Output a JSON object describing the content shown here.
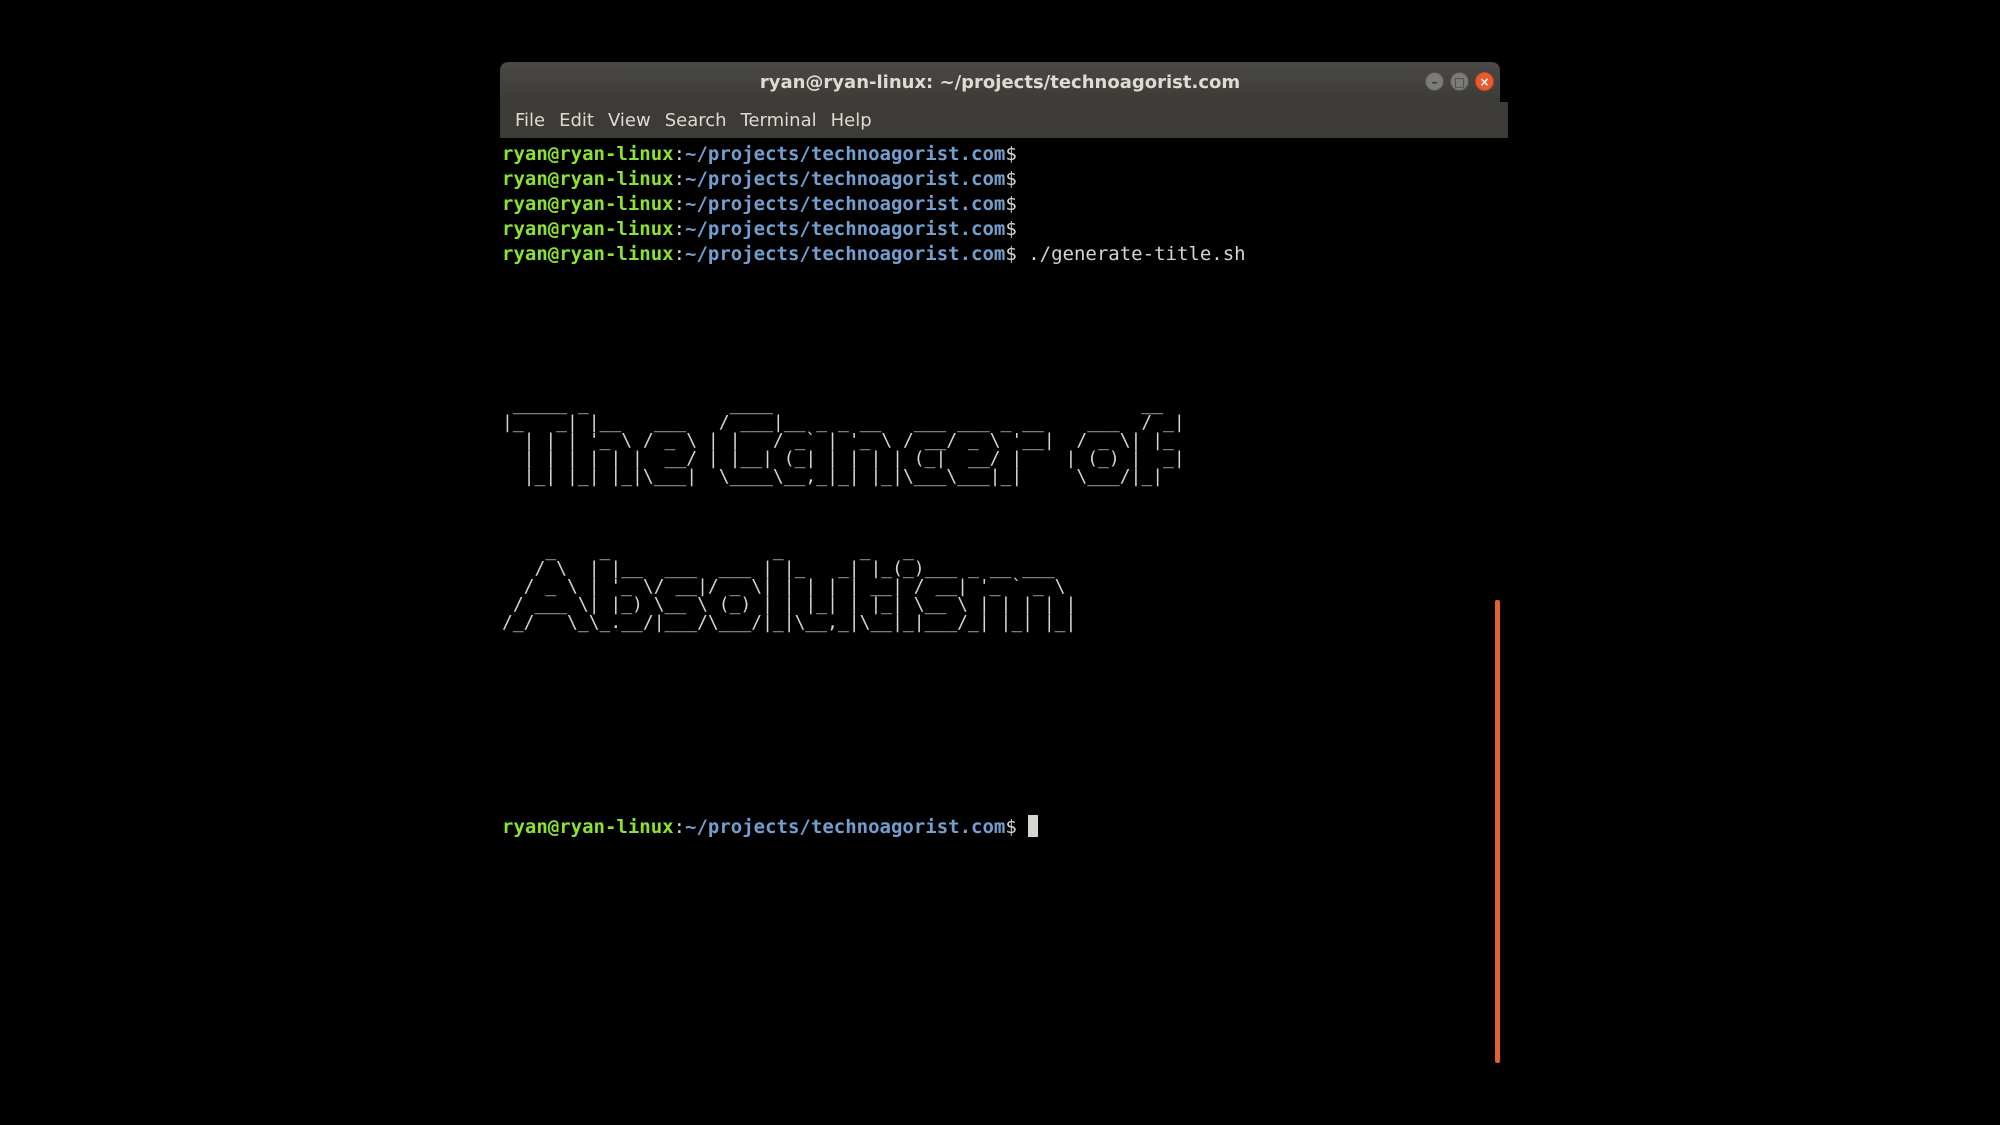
{
  "window": {
    "title": "ryan@ryan-linux: ~/projects/technoagorist.com",
    "controls": [
      "minimize-icon",
      "maximize-icon",
      "close-icon"
    ]
  },
  "menu": [
    "File",
    "Edit",
    "View",
    "Search",
    "Terminal",
    "Help"
  ],
  "prompt": {
    "user_host": "ryan@ryan-linux",
    "separator": ":",
    "path": "~/projects/technoagorist.com",
    "sign": "$"
  },
  "terminal": {
    "command": " ./generate-title.sh",
    "ascii_title": [
      " _____ _             ____                                  __ ",
      "|_   _| |__   ___   / ___|__ _ _ __   ___ ___ _ __    ___  / _|",
      "  | | | '_ \\ / _ \\ | |   / _` | '_ \\ / __/ _ \\ '__|  / _ \\| |_ ",
      "  | | | | | |  __/ | |__| (_| | | | | (_|  __/ |    | (_) |  _|",
      "  |_| |_| |_|\\___|  \\____\\__,_|_| |_|\\___\\___|_|     \\___/|_|  "
    ],
    "ascii_subtitle": [
      "    _    _               _       _   _                ",
      "   / \\  | |__  ___  ___ | |_   _| |_(_)___ _ __ ___   ",
      "  / _ \\ | '_ \\/ __|/ _ \\| | | | | __| / __| '_ ` _ \\  ",
      " / ___ \\| |_) \\__ \\ (_) | | |_| | |_| \\__ \\ | | | | | ",
      "/_/   \\_\\_.__/|___/\\___/|_|\\__,_|\\__|_|___/_| |_| |_| "
    ]
  },
  "colors": {
    "user": "#8ae234",
    "path": "#729fcf",
    "scrollbar": "#e0632d",
    "titlebar": "#3c3b37"
  }
}
